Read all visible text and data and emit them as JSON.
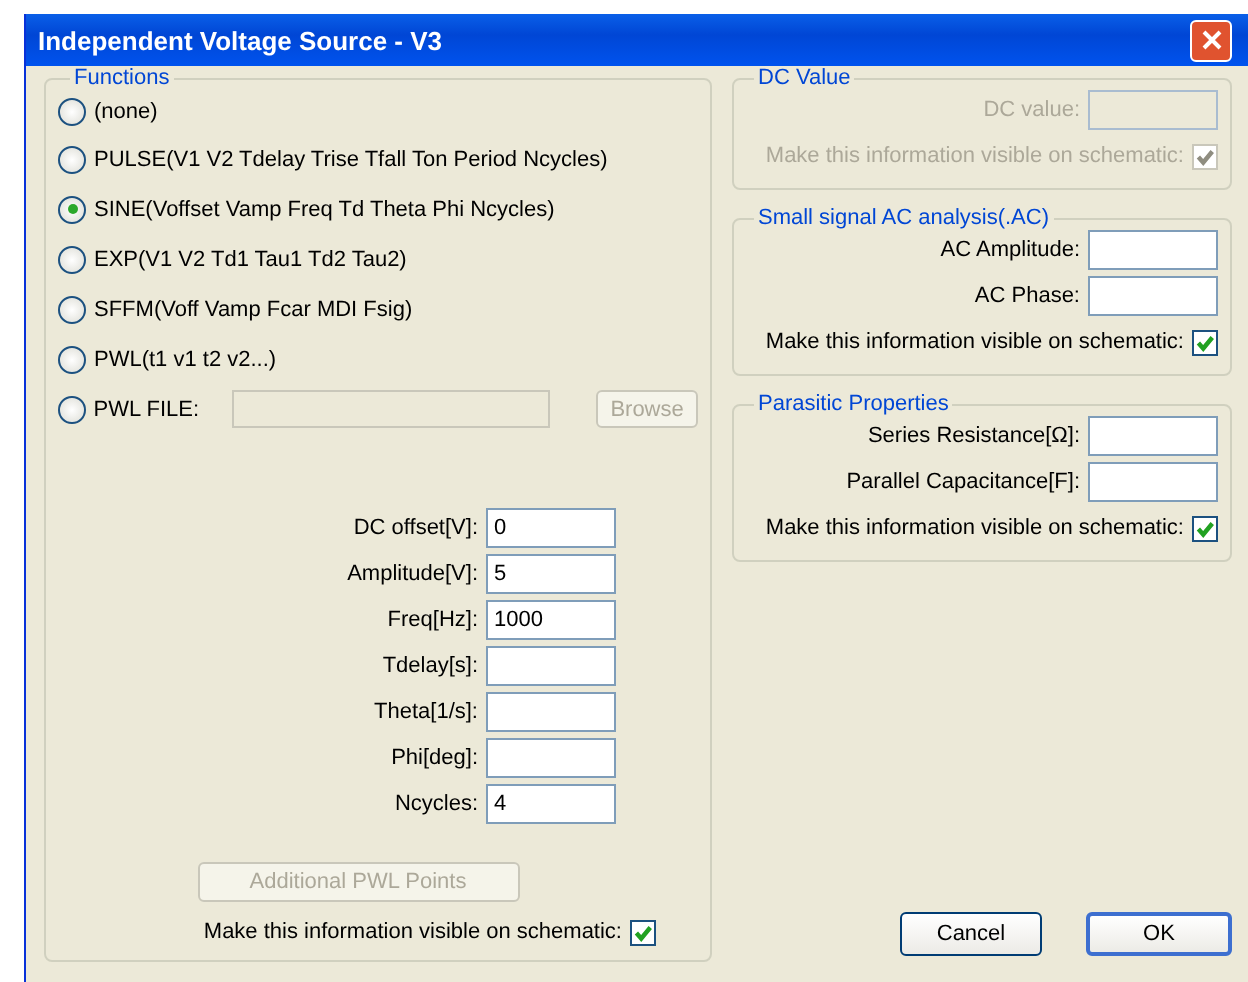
{
  "window": {
    "title": "Independent Voltage Source - V3"
  },
  "functions": {
    "title": "Functions",
    "options": [
      {
        "label": "(none)",
        "selected": false,
        "kind": "plain"
      },
      {
        "label": "PULSE(V1 V2 Tdelay Trise Tfall Ton Period Ncycles)",
        "selected": false,
        "kind": "plain"
      },
      {
        "label": "SINE(Voffset Vamp Freq Td Theta Phi Ncycles)",
        "selected": true,
        "kind": "plain"
      },
      {
        "label": "EXP(V1 V2 Td1 Tau1 Td2 Tau2)",
        "selected": false,
        "kind": "plain"
      },
      {
        "label": "SFFM(Voff Vamp Fcar MDI Fsig)",
        "selected": false,
        "kind": "plain"
      },
      {
        "label": "PWL(t1 v1 t2 v2...)",
        "selected": false,
        "kind": "plain"
      },
      {
        "label": "PWL FILE:",
        "selected": false,
        "kind": "file",
        "browse": "Browse",
        "disabled": true
      }
    ],
    "parameters": [
      {
        "label": "DC offset[V]:",
        "value": "0"
      },
      {
        "label": "Amplitude[V]:",
        "value": "5"
      },
      {
        "label": "Freq[Hz]:",
        "value": "1000"
      },
      {
        "label": "Tdelay[s]:"
      },
      {
        "label": "Theta[1/s]:"
      },
      {
        "label": "Phi[deg]:"
      },
      {
        "label": "Ncycles:",
        "value": "4"
      }
    ],
    "additional_button": {
      "label": "Additional PWL Points",
      "disabled": true
    },
    "visible_on_schematic": {
      "label": "Make this information visible on schematic:",
      "checked": true
    }
  },
  "right_groups": [
    {
      "title": "DC Value",
      "disabled": true,
      "fields": [
        {
          "label": "DC value:"
        }
      ],
      "visible_on_schematic": {
        "label": "Make this information visible on schematic:",
        "checked": true
      }
    },
    {
      "title": "Small signal AC analysis(.AC)",
      "disabled": false,
      "fields": [
        {
          "label": "AC Amplitude:"
        },
        {
          "label": "AC Phase:"
        }
      ],
      "visible_on_schematic": {
        "label": "Make this information visible on schematic:",
        "checked": true
      }
    },
    {
      "title": "Parasitic Properties",
      "disabled": false,
      "fields": [
        {
          "label": "Series Resistance[Ω]:"
        },
        {
          "label": "Parallel Capacitance[F]:"
        }
      ],
      "visible_on_schematic": {
        "label": "Make this information visible on schematic:",
        "checked": true
      }
    }
  ],
  "buttons": [
    {
      "label": "Cancel",
      "default": false
    },
    {
      "label": "OK",
      "default": true
    }
  ]
}
